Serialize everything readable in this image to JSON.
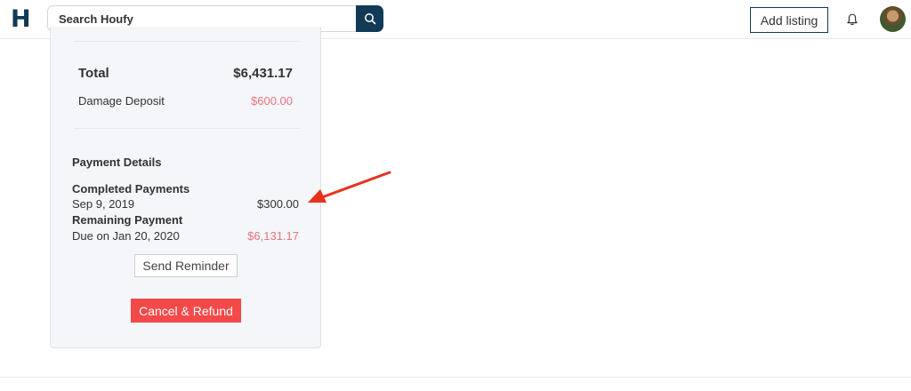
{
  "header": {
    "logo": "H",
    "search": {
      "placeholder": "Search Houfy"
    },
    "add_listing_label": "Add listing",
    "icons": {
      "search": "search-icon",
      "notifications": "bell-icon",
      "avatar": "user-avatar"
    }
  },
  "summary": {
    "total_label": "Total",
    "total_value": "$6,431.17",
    "deposit_label": "Damage Deposit",
    "deposit_value": "$600.00"
  },
  "payment_details": {
    "header": "Payment Details",
    "completed_header": "Completed Payments",
    "completed": [
      {
        "date": "Sep 9, 2019",
        "amount": "$300.00"
      }
    ],
    "remaining_header": "Remaining Payment",
    "remaining": {
      "due": "Due on Jan 20, 2020",
      "amount": "$6,131.17"
    }
  },
  "actions": {
    "send_reminder": "Send Reminder",
    "cancel_refund": "Cancel & Refund"
  },
  "colors": {
    "brand": "#123a57",
    "accent_red": "#f44949",
    "amount_red": "#e8747a",
    "annotation_arrow": "#e8321e"
  }
}
